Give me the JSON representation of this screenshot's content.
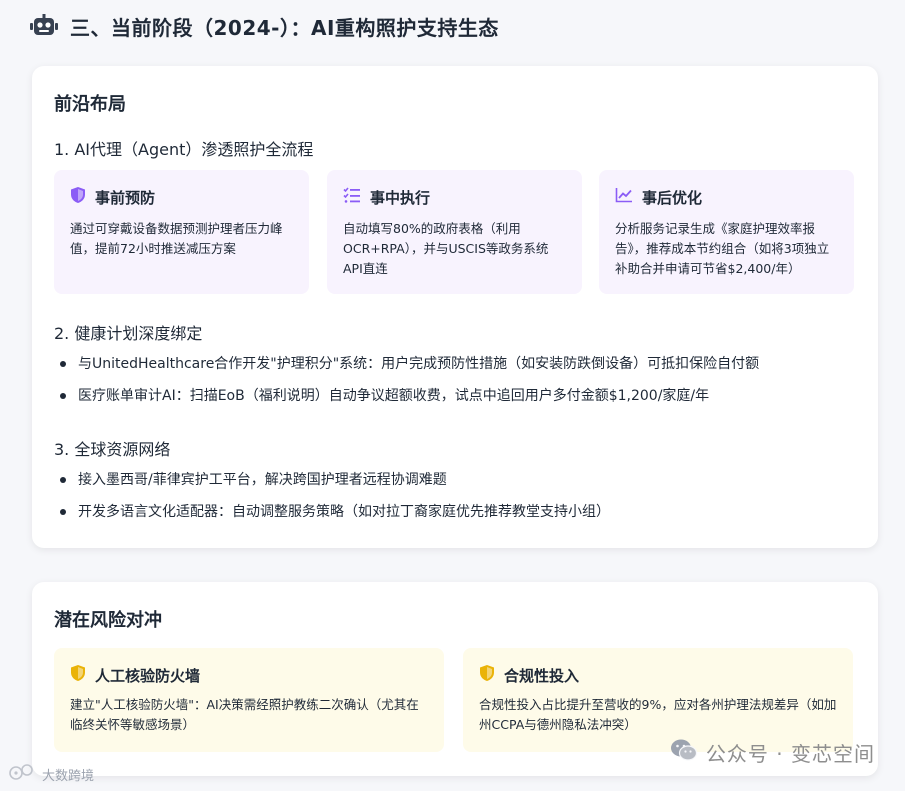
{
  "header": {
    "title": "三、当前阶段（2024-）：AI重构照护支持生态",
    "icon": "robot-icon"
  },
  "frontier": {
    "title": "前沿布局",
    "group1": {
      "title": "1. AI代理（Agent）渗透照护全流程",
      "boxes": [
        {
          "icon": "shield-icon",
          "title": "事前预防",
          "desc": "通过可穿戴设备数据预测护理者压力峰值，提前72小时推送减压方案"
        },
        {
          "icon": "checklist-icon",
          "title": "事中执行",
          "desc": "自动填写80%的政府表格（利用OCR+RPA），并与USCIS等政务系统API直连"
        },
        {
          "icon": "chart-line-icon",
          "title": "事后优化",
          "desc": "分析服务记录生成《家庭护理效率报告》，推荐成本节约组合（如将3项独立补助合并申请可节省$2,400/年）"
        }
      ]
    },
    "group2": {
      "title": "2. 健康计划深度绑定",
      "items": [
        "与UnitedHealthcare合作开发\"护理积分\"系统：用户完成预防性措施（如安装防跌倒设备）可抵扣保险自付额",
        "医疗账单审计AI：扫描EoB（福利说明）自动争议超额收费，试点中追回用户多付金额$1,200/家庭/年"
      ]
    },
    "group3": {
      "title": "3. 全球资源网络",
      "items": [
        "接入墨西哥/菲律宾护工平台，解决跨国护理者远程协调难题",
        "开发多语言文化适配器：自动调整服务策略（如对拉丁裔家庭优先推荐教堂支持小组）"
      ]
    }
  },
  "risk": {
    "title": "潜在风险对冲",
    "boxes": [
      {
        "icon": "shield-icon",
        "title": "人工核验防火墙",
        "desc": "建立\"人工核验防火墙\"：AI决策需经照护教练二次确认（尤其在临终关怀等敏感场景）"
      },
      {
        "icon": "shield-icon",
        "title": "合规性投入",
        "desc": "合规性投入占比提升至营收的9%，应对各州护理法规差异（如加州CCPA与德州隐私法冲突）"
      }
    ]
  },
  "watermarks": {
    "right": "公众号 · 变芯空间",
    "left": "大数跨境"
  },
  "colors": {
    "purple_accent": "#8b5cf6",
    "purple_box": "#f8f3fe",
    "yellow_accent": "#eab308",
    "yellow_box": "#fefbe9"
  }
}
